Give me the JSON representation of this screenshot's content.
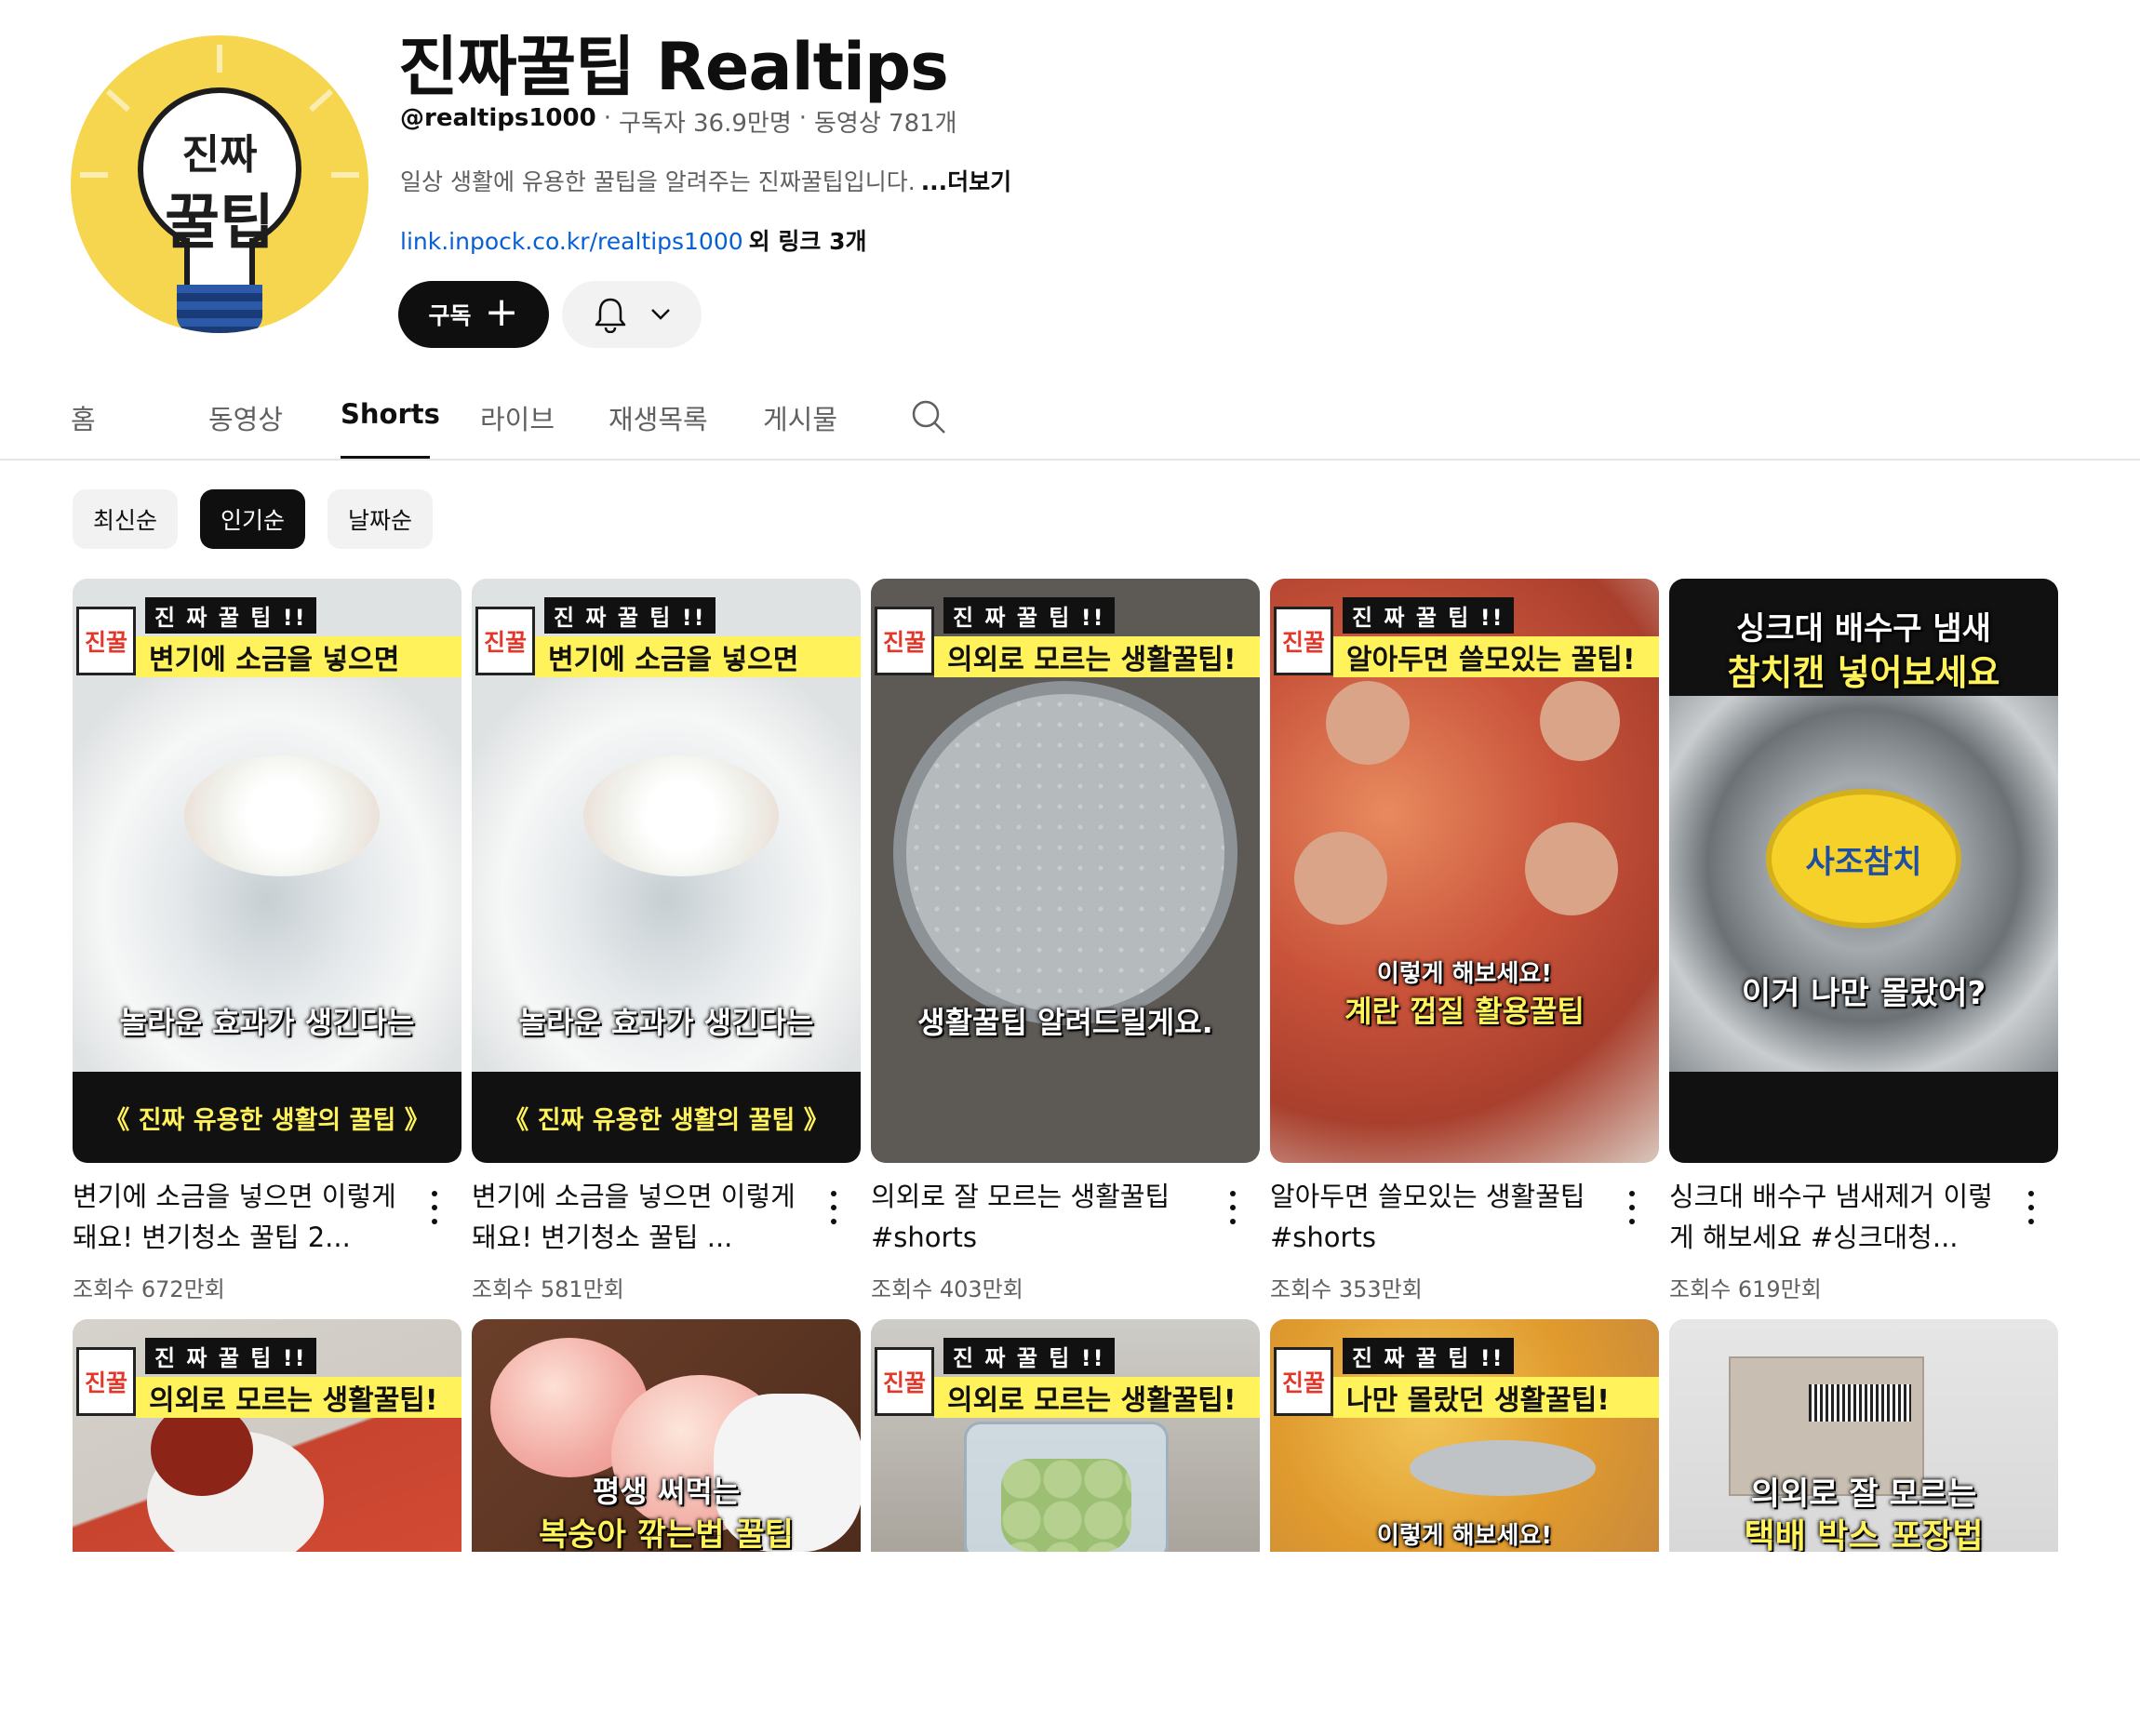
{
  "channel": {
    "avatar_text_top": "진짜",
    "avatar_text_bottom": "꿀팁",
    "name": "진짜꿀팁 Realtips",
    "handle": "@realtips1000",
    "separator": "·",
    "subscribers": "구독자 36.9만명",
    "video_count": "동영상 781개",
    "description": "일상 생활에 유용한 꿀팁을 알려주는 진짜꿀팁입니다.",
    "more_label": "...더보기",
    "link_url": "link.inpock.co.kr/realtips1000",
    "link_extra": "외 링크 3개",
    "subscribe_label": "구독"
  },
  "tabs": [
    {
      "label": "홈"
    },
    {
      "label": "동영상"
    },
    {
      "label": "Shorts",
      "active": true
    },
    {
      "label": "라이브"
    },
    {
      "label": "재생목록"
    },
    {
      "label": "게시물"
    }
  ],
  "chips": [
    {
      "label": "최신순"
    },
    {
      "label": "인기순",
      "active": true
    },
    {
      "label": "날짜순"
    }
  ],
  "shorts": [
    {
      "title": "변기에 소금을 넣으면 이렇게 돼요! 변기청소 꿀팁 2...",
      "views": "조회수 672만회",
      "overlay": {
        "badge_sub": "진 짜 꿀 팁 !!",
        "badge_main": "변기에 소금을 넣으면",
        "caption": "놀라운 효과가 생긴다는",
        "band": "《 진짜 유용한 생활의 꿀팁 》"
      }
    },
    {
      "title": "변기에 소금을 넣으면 이렇게 돼요! 변기청소 꿀팁 ...",
      "views": "조회수 581만회",
      "overlay": {
        "badge_sub": "진 짜 꿀 팁 !!",
        "badge_main": "변기에 소금을 넣으면",
        "caption": "놀라운 효과가 생긴다는",
        "band": "《 진짜 유용한 생활의 꿀팁 》"
      }
    },
    {
      "title": "의외로 잘 모르는 생활꿀팁 #shorts",
      "views": "조회수 403만회",
      "overlay": {
        "badge_sub": "진 짜 꿀 팁 !!",
        "badge_main": "의외로 모르는 생활꿀팁!",
        "caption": "생활꿀팁 알려드릴게요."
      }
    },
    {
      "title": "알아두면 쓸모있는 생활꿀팁 #shorts",
      "views": "조회수 353만회",
      "overlay": {
        "badge_sub": "진 짜 꿀 팁 !!",
        "badge_main": "알아두면 쓸모있는 꿀팁!",
        "caption_small": "이렇게 해보세요!",
        "caption": "계란 껍질 활용꿀팁"
      }
    },
    {
      "title": "싱크대 배수구 냄새제거 이렇게 해보세요 #싱크대청...",
      "views": "조회수 619만회",
      "overlay": {
        "top_line1": "싱크대 배수구 냄새",
        "top_line2": "참치캔 넣어보세요",
        "can_label": "사조참치",
        "caption": "이거 나만 몰랐어?"
      }
    }
  ],
  "shorts_row2": [
    {
      "overlay": {
        "badge_sub": "진 짜 꿀 팁 !!",
        "badge_main": "의외로 모르는 생활꿀팁!"
      }
    },
    {
      "overlay": {
        "caption_line1": "평생 써먹는",
        "caption_line2": "복숭아 깎는법 꿀팁"
      }
    },
    {
      "overlay": {
        "badge_sub": "진 짜 꿀 팁 !!",
        "badge_main": "의외로 모르는 생활꿀팁!"
      }
    },
    {
      "overlay": {
        "badge_sub": "진 짜 꿀 팁 !!",
        "badge_main": "나만 몰랐던 생활꿀팁!",
        "caption_small": "이렇게 해보세요!"
      }
    },
    {
      "overlay": {
        "caption_line1": "의외로 잘 모르는",
        "caption_line2": "택배 박스 포장법"
      }
    }
  ],
  "badge_mark": "진꿀",
  "colors": {
    "accent_yellow": "#fff25a",
    "brand_red": "#e4372a",
    "link_blue": "#065fd4"
  }
}
